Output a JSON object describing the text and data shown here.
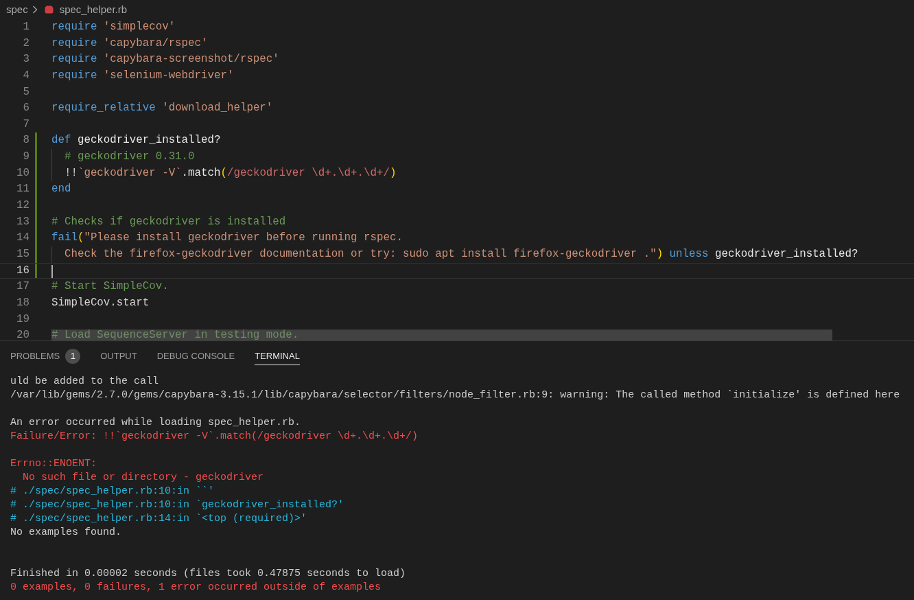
{
  "breadcrumb": {
    "folder": "spec",
    "file": "spec_helper.rb"
  },
  "editor": {
    "lines": [
      {
        "number": "1",
        "modified": false,
        "current": false,
        "indent_guide": false,
        "tokens": [
          {
            "kind": "keyword",
            "text": "require"
          },
          {
            "kind": "string",
            "text": " 'simplecov'"
          }
        ]
      },
      {
        "number": "2",
        "modified": false,
        "current": false,
        "indent_guide": false,
        "tokens": [
          {
            "kind": "keyword",
            "text": "require"
          },
          {
            "kind": "string",
            "text": " 'capybara/rspec'"
          }
        ]
      },
      {
        "number": "3",
        "modified": false,
        "current": false,
        "indent_guide": false,
        "tokens": [
          {
            "kind": "keyword",
            "text": "require"
          },
          {
            "kind": "string",
            "text": " 'capybara-screenshot/rspec'"
          }
        ]
      },
      {
        "number": "4",
        "modified": false,
        "current": false,
        "indent_guide": false,
        "tokens": [
          {
            "kind": "keyword",
            "text": "require"
          },
          {
            "kind": "string",
            "text": " 'selenium-webdriver'"
          }
        ]
      },
      {
        "number": "5",
        "modified": false,
        "current": false,
        "indent_guide": false
      },
      {
        "number": "6",
        "modified": false,
        "current": false,
        "indent_guide": false,
        "tokens": [
          {
            "kind": "keyword",
            "text": "require_relative"
          },
          {
            "kind": "string",
            "text": " 'download_helper'"
          }
        ]
      },
      {
        "number": "7",
        "modified": false,
        "current": false,
        "indent_guide": false
      },
      {
        "number": "8",
        "modified": true,
        "current": false,
        "indent_guide": false,
        "tokens": [
          {
            "kind": "keyword",
            "text": "def"
          },
          {
            "kind": "name",
            "text": " geckodriver_installed?"
          }
        ]
      },
      {
        "number": "9",
        "modified": true,
        "current": false,
        "indent_guide": true,
        "tokens": [
          {
            "kind": "comment",
            "text": "  # geckodriver 0.31.0"
          }
        ]
      },
      {
        "number": "10",
        "modified": true,
        "current": false,
        "indent_guide": true,
        "tokens": [
          {
            "kind": "plain",
            "text": "  !!"
          },
          {
            "kind": "string",
            "text": "`geckodriver -V`"
          },
          {
            "kind": "name",
            "text": ".match"
          },
          {
            "kind": "bracket",
            "text": "("
          },
          {
            "kind": "regex",
            "text": "/geckodriver \\d+.\\d+.\\d+/"
          },
          {
            "kind": "bracket",
            "text": ")"
          }
        ]
      },
      {
        "number": "11",
        "modified": true,
        "current": false,
        "indent_guide": false,
        "tokens": [
          {
            "kind": "keyword",
            "text": "end"
          }
        ]
      },
      {
        "number": "12",
        "modified": true,
        "current": false,
        "indent_guide": false
      },
      {
        "number": "13",
        "modified": true,
        "current": false,
        "indent_guide": false,
        "tokens": [
          {
            "kind": "comment",
            "text": "# Checks if geckodriver is installed"
          }
        ]
      },
      {
        "number": "14",
        "modified": true,
        "current": false,
        "indent_guide": false,
        "tokens": [
          {
            "kind": "keyword",
            "text": "fail"
          },
          {
            "kind": "bracket",
            "text": "("
          },
          {
            "kind": "string",
            "text": "\"Please install geckodriver before running rspec."
          }
        ]
      },
      {
        "number": "15",
        "modified": true,
        "current": false,
        "indent_guide": true,
        "tokens": [
          {
            "kind": "string",
            "text": "  Check the firefox-geckodriver documentation or try: sudo apt install firefox-geckodriver .\""
          },
          {
            "kind": "bracket",
            "text": ")"
          },
          {
            "kind": "keyword",
            "text": " unless"
          },
          {
            "kind": "name",
            "text": " geckodriver_installed?"
          }
        ]
      },
      {
        "number": "16",
        "modified": true,
        "current": true,
        "indent_guide": false
      },
      {
        "number": "17",
        "modified": false,
        "current": false,
        "indent_guide": false,
        "tokens": [
          {
            "kind": "comment",
            "text": "# Start SimpleCov."
          }
        ]
      },
      {
        "number": "18",
        "modified": false,
        "current": false,
        "indent_guide": false,
        "tokens": [
          {
            "kind": "plain",
            "text": "SimpleCov.start"
          }
        ]
      },
      {
        "number": "19",
        "modified": false,
        "current": false,
        "indent_guide": false
      },
      {
        "number": "20",
        "modified": false,
        "current": false,
        "indent_guide": false,
        "tokens": [
          {
            "kind": "comment",
            "text": "# Load SequenceServer in testing mode."
          }
        ]
      }
    ]
  },
  "panel": {
    "tabs": [
      {
        "label": "PROBLEMS",
        "badge": "1",
        "selected": false
      },
      {
        "label": "OUTPUT",
        "selected": false
      },
      {
        "label": "DEBUG CONSOLE",
        "selected": false
      },
      {
        "label": "TERMINAL",
        "selected": true
      }
    ],
    "terminal": [
      {
        "kind": "plain",
        "text": "uld be added to the call"
      },
      {
        "kind": "plain",
        "text": "/var/lib/gems/2.7.0/gems/capybara-3.15.1/lib/capybara/selector/filters/node_filter.rb:9: warning: The called method `initialize' is defined here"
      },
      {
        "kind": "blank"
      },
      {
        "kind": "plain",
        "text": "An error occurred while loading spec_helper.rb."
      },
      {
        "kind": "error",
        "text": "Failure/Error: !!`geckodriver -V`.match(/geckodriver \\d+.\\d+.\\d+/)"
      },
      {
        "kind": "blank"
      },
      {
        "kind": "error",
        "text": "Errno::ENOENT:"
      },
      {
        "kind": "error",
        "text": "  No such file or directory - geckodriver"
      },
      {
        "kind": "trace",
        "text": "# ./spec/spec_helper.rb:10:in ``'"
      },
      {
        "kind": "trace",
        "text": "# ./spec/spec_helper.rb:10:in `geckodriver_installed?'"
      },
      {
        "kind": "trace",
        "text": "# ./spec/spec_helper.rb:14:in `<top (required)>'"
      },
      {
        "kind": "plain",
        "text": "No examples found."
      },
      {
        "kind": "blank"
      },
      {
        "kind": "blank"
      },
      {
        "kind": "plain",
        "text": "Finished in 0.00002 seconds (files took 0.47875 seconds to load)"
      },
      {
        "kind": "error",
        "text": "0 examples, 0 failures, 1 error occurred outside of examples"
      }
    ]
  }
}
